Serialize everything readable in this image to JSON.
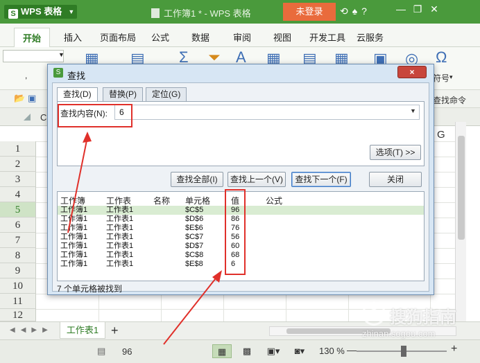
{
  "titlebar": {
    "app_name": "WPS 表格",
    "app_logo": "S",
    "doc_title": "工作簿1 * - WPS 表格",
    "login": "未登录",
    "icons": [
      "refresh-icon",
      "shirt-icon",
      "help-icon"
    ],
    "window_buttons": [
      "minimize",
      "restore",
      "close"
    ]
  },
  "menu": {
    "tabs": [
      "开始",
      "插入",
      "页面布局",
      "公式",
      "数据",
      "审阅",
      "视图",
      "开发工具",
      "云服务"
    ],
    "active": "开始"
  },
  "ribbon": {
    "symbol_label": "符号"
  },
  "quick_access": {
    "find_command": "查找命令"
  },
  "grid": {
    "columns_visible": [
      "C",
      "G"
    ],
    "rows": [
      "1",
      "2",
      "3",
      "4",
      "5",
      "6",
      "7",
      "8",
      "9",
      "10",
      "11",
      "12"
    ],
    "selected_row": "5"
  },
  "sheets": {
    "tabs": [
      "工作表1"
    ],
    "add": "+"
  },
  "statusbar": {
    "sum_value": "96",
    "zoom": "130 %",
    "zoom_level_percent": 130
  },
  "dialog": {
    "logo": "S",
    "title": "查找",
    "close_label": "×",
    "tabs": [
      "查找(D)",
      "替换(P)",
      "定位(G)"
    ],
    "active_tab": "查找(D)",
    "find_label": "查找内容(N):",
    "find_value": "6",
    "options_button": "选项(T) >>",
    "buttons": {
      "find_all": "查找全部(I)",
      "find_prev": "查找上一个(V)",
      "find_next": "查找下一个(F)",
      "close": "关闭"
    },
    "results": {
      "headers": [
        "工作簿",
        "工作表",
        "名称",
        "单元格",
        "值",
        "公式"
      ],
      "rows": [
        {
          "book": "工作簿1",
          "sheet": "工作表1",
          "cell": "$C$5",
          "value": "96"
        },
        {
          "book": "工作簿1",
          "sheet": "工作表1",
          "cell": "$D$6",
          "value": "86"
        },
        {
          "book": "工作簿1",
          "sheet": "工作表1",
          "cell": "$E$6",
          "value": "76"
        },
        {
          "book": "工作簿1",
          "sheet": "工作表1",
          "cell": "$C$7",
          "value": "56"
        },
        {
          "book": "工作簿1",
          "sheet": "工作表1",
          "cell": "$D$7",
          "value": "60"
        },
        {
          "book": "工作簿1",
          "sheet": "工作表1",
          "cell": "$C$8",
          "value": "68"
        },
        {
          "book": "工作簿1",
          "sheet": "工作表1",
          "cell": "$E$8",
          "value": "6"
        }
      ]
    },
    "status": "7 个单元格被找到"
  },
  "annotations": {
    "highlight_color": "#e0302a"
  },
  "watermark": {
    "text": "搜狗指南",
    "url": "zhinan.sogou.com"
  },
  "colors": {
    "brand_green": "#4a9a3c",
    "dialog_bg": "#d7e6f4",
    "login_orange": "#e96b3c"
  }
}
